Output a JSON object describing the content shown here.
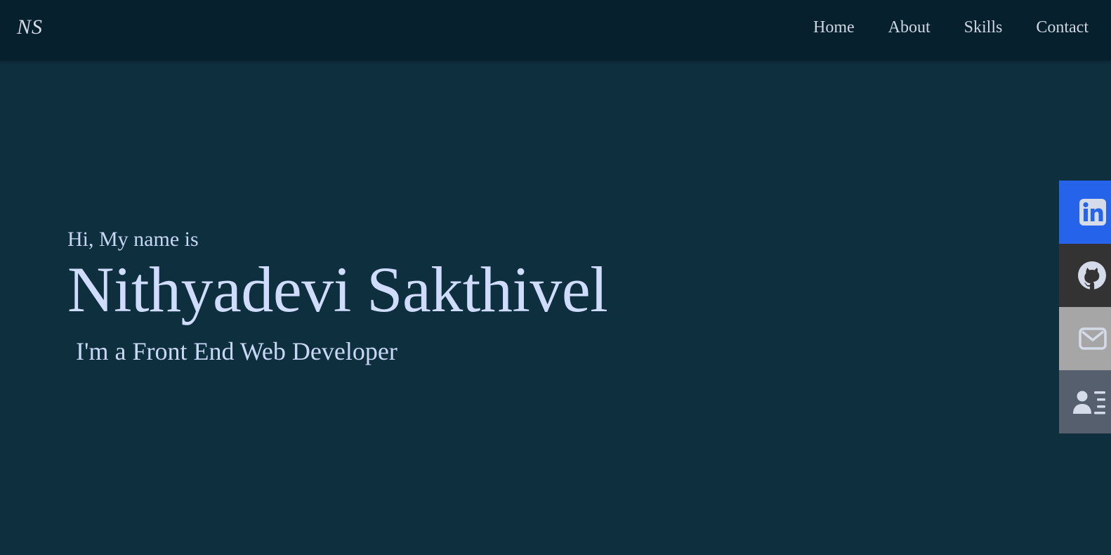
{
  "navbar": {
    "logo": "NS",
    "links": [
      {
        "label": "Home"
      },
      {
        "label": "About"
      },
      {
        "label": "Skills"
      },
      {
        "label": "Contact"
      }
    ]
  },
  "hero": {
    "greeting": "Hi, My name is",
    "name": "Nithyadevi Sakthivel",
    "tagline": "I'm a Front End Web Developer"
  },
  "social": [
    {
      "icon": "linkedin-icon",
      "color": "#2563eb"
    },
    {
      "icon": "github-icon",
      "color": "#333333"
    },
    {
      "icon": "mail-icon",
      "color": "#a6a6a6"
    },
    {
      "icon": "resume-icon",
      "color": "#565f6d"
    }
  ],
  "colors": {
    "page_bg": "#0e2f3e",
    "navbar_bg": "#06212d",
    "text": "#cfdcfb"
  }
}
